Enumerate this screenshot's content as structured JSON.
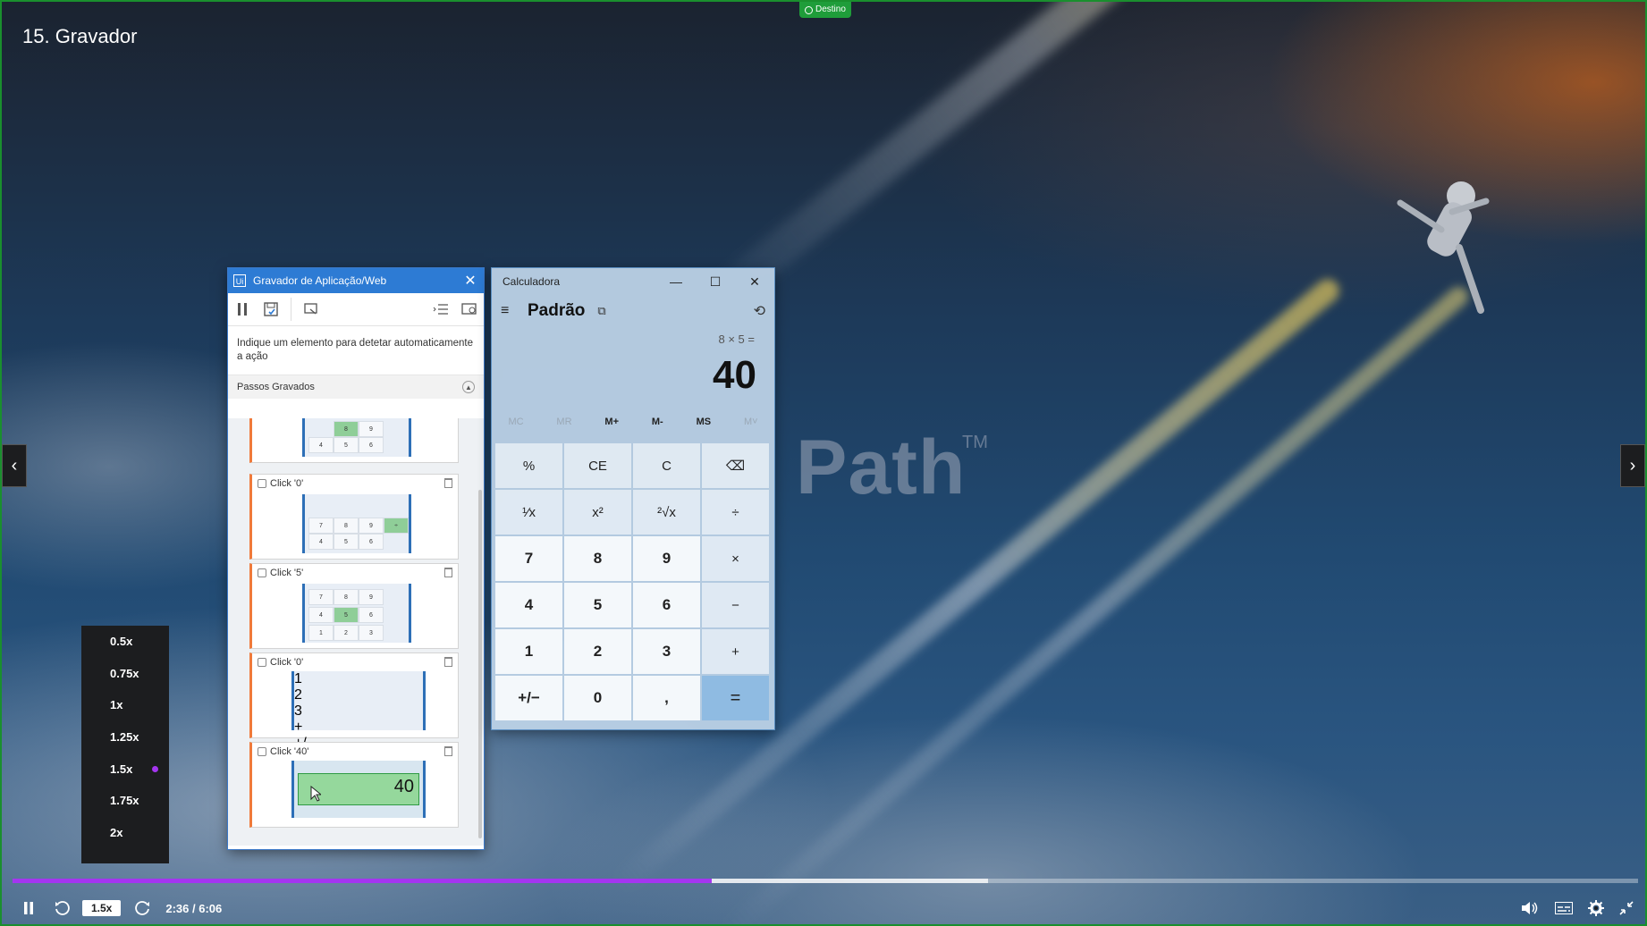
{
  "lesson": {
    "title": "15. Gravador"
  },
  "badge": {
    "label": "Destino"
  },
  "watermark": {
    "text": "Path",
    "tm": "TM"
  },
  "recorder": {
    "title": "Gravador de Aplicação/Web",
    "app_icon": "Ui",
    "hint": "Indique um elemento para detetar automaticamente a ação",
    "section": "Passos Gravados",
    "steps": [
      {
        "label": "Click '0'"
      },
      {
        "label": "Click '5'"
      },
      {
        "label": "Click '0'"
      },
      {
        "label": "Click '40'",
        "value": "40"
      }
    ]
  },
  "calculator": {
    "title": "Calculadora",
    "mode": "Padrão",
    "expression": "8 × 5 =",
    "display": "40",
    "memory": [
      "MC",
      "MR",
      "M+",
      "M-",
      "MS",
      "M˅"
    ],
    "keys": [
      "%",
      "CE",
      "C",
      "⌫",
      "¹⁄x",
      "x²",
      "²√x",
      "÷",
      "7",
      "8",
      "9",
      "×",
      "4",
      "5",
      "6",
      "−",
      "1",
      "2",
      "3",
      "+",
      "+/−",
      "0",
      ",",
      "="
    ]
  },
  "speed_menu": {
    "options": [
      "0.5x",
      "0.75x",
      "1x",
      "1.25x",
      "1.5x",
      "1.75x",
      "2x"
    ],
    "selected": "1.5x"
  },
  "player": {
    "speed": "1.5x",
    "time": "2:36 / 6:06",
    "progress": 0.43,
    "buffered": 0.6
  },
  "colors": {
    "accent": "#a435f0",
    "border": "#1a8f2e"
  }
}
